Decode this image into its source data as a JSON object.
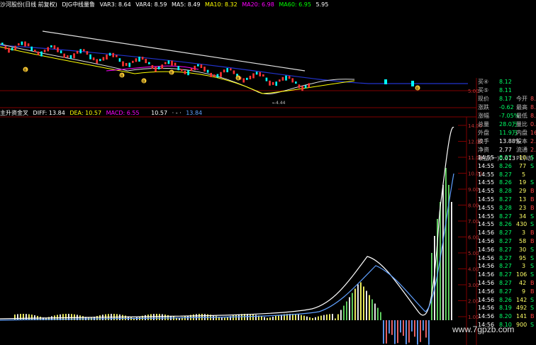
{
  "header": {
    "title": "沙河股份(日线 前复权)",
    "indicator_name": "DJG中线量鲁",
    "var3": "VAR3: 8.64",
    "var4": "VAR4: 8.59",
    "ma5": "MA5: 8.49",
    "ma10": "MA10: 8.32",
    "ma20": "MA20: 6.98",
    "ma60": "MA60: 6.95",
    "extra": "5.95"
  },
  "colors": {
    "up": "#ff3232",
    "down": "#00ffff",
    "grid": "#800000",
    "ma5": "#ffffff",
    "ma10": "#ffff00",
    "ma20": "#ff00ff",
    "ma60": "#00ff00",
    "macd_pos": "#ffff66",
    "macd_neg": "#5fa0ff"
  },
  "price_chart": {
    "low_label": "4.44",
    "buy_marker": "B",
    "axis_right": [
      "5.00"
    ]
  },
  "macd": {
    "title": "主升资金叉",
    "diff": "DIFF: 13.84",
    "dea": "DEA: 10.57",
    "macd": "MACD: 6.55",
    "extra1": "10.57",
    "extra2": "·  -  ·",
    "extra3": "13.84",
    "axis": [
      "14.00",
      "12.00",
      "11.00",
      "10.00",
      "9.00",
      "8.00",
      "7.00",
      "6.00",
      "5.00",
      "4.00",
      "3.00",
      "2.00",
      "1.00"
    ]
  },
  "quote_panel": {
    "rows": [
      {
        "l1": "买④",
        "v1": "8.12",
        "l2": "",
        "v2": ""
      },
      {
        "l1": "买⑤",
        "v1": "8.11",
        "l2": "",
        "v2": ""
      },
      {
        "l1": "现价",
        "v1": "8.17",
        "l2": "今开",
        "v2": "8."
      },
      {
        "l1": "涨跌",
        "v1": "-0.62",
        "l2": "最高",
        "v2": "8."
      },
      {
        "l1": "涨幅",
        "v1": "-7.05%",
        "l2": "最低",
        "v2": "8."
      },
      {
        "l1": "总量",
        "v1": "28.0万",
        "l2": "量比",
        "v2": "0."
      },
      {
        "l1": "外盘",
        "v1": "11.9万",
        "l2": "内盘",
        "v2": "16.1"
      },
      {
        "l1": "换手",
        "v1": "13.88%",
        "l2": "股本",
        "v2": "2.02"
      },
      {
        "l1": "净资",
        "v1": "2.77",
        "l2": "流通",
        "v2": "2.02"
      },
      {
        "l1": "收益(一)",
        "v1": "0.013",
        "l2": "PE(动)",
        "v2": ""
      }
    ]
  },
  "trades": [
    {
      "t": "14:55",
      "p": "8.27",
      "v": "10",
      "d": "S"
    },
    {
      "t": "14:55",
      "p": "8.26",
      "v": "77",
      "d": "S"
    },
    {
      "t": "14:55",
      "p": "8.27",
      "v": "5",
      "d": ""
    },
    {
      "t": "14:55",
      "p": "8.26",
      "v": "19",
      "d": "S"
    },
    {
      "t": "14:55",
      "p": "8.28",
      "v": "29",
      "d": "B"
    },
    {
      "t": "14:55",
      "p": "8.27",
      "v": "13",
      "d": "B"
    },
    {
      "t": "14:55",
      "p": "8.28",
      "v": "23",
      "d": "B"
    },
    {
      "t": "14:55",
      "p": "8.27",
      "v": "34",
      "d": "S"
    },
    {
      "t": "14:55",
      "p": "8.26",
      "v": "430",
      "d": "S"
    },
    {
      "t": "14:56",
      "p": "8.27",
      "v": "3",
      "d": "B"
    },
    {
      "t": "14:56",
      "p": "8.27",
      "v": "58",
      "d": "B"
    },
    {
      "t": "14:56",
      "p": "8.27",
      "v": "30",
      "d": "S"
    },
    {
      "t": "14:56",
      "p": "8.27",
      "v": "95",
      "d": "S"
    },
    {
      "t": "14:56",
      "p": "8.27",
      "v": "3",
      "d": "S"
    },
    {
      "t": "14:56",
      "p": "8.27",
      "v": "106",
      "d": "S"
    },
    {
      "t": "14:56",
      "p": "8.27",
      "v": "42",
      "d": "B"
    },
    {
      "t": "14:56",
      "p": "8.27",
      "v": "9",
      "d": "B"
    },
    {
      "t": "14:56",
      "p": "8.26",
      "v": "142",
      "d": "S"
    },
    {
      "t": "14:56",
      "p": "8.19",
      "v": "492",
      "d": "S"
    },
    {
      "t": "14:56",
      "p": "8.20",
      "v": "141",
      "d": "B"
    },
    {
      "t": "14:56",
      "p": "8.10",
      "v": "900",
      "d": "S"
    }
  ],
  "watermark": "www.7gpzb.com"
}
